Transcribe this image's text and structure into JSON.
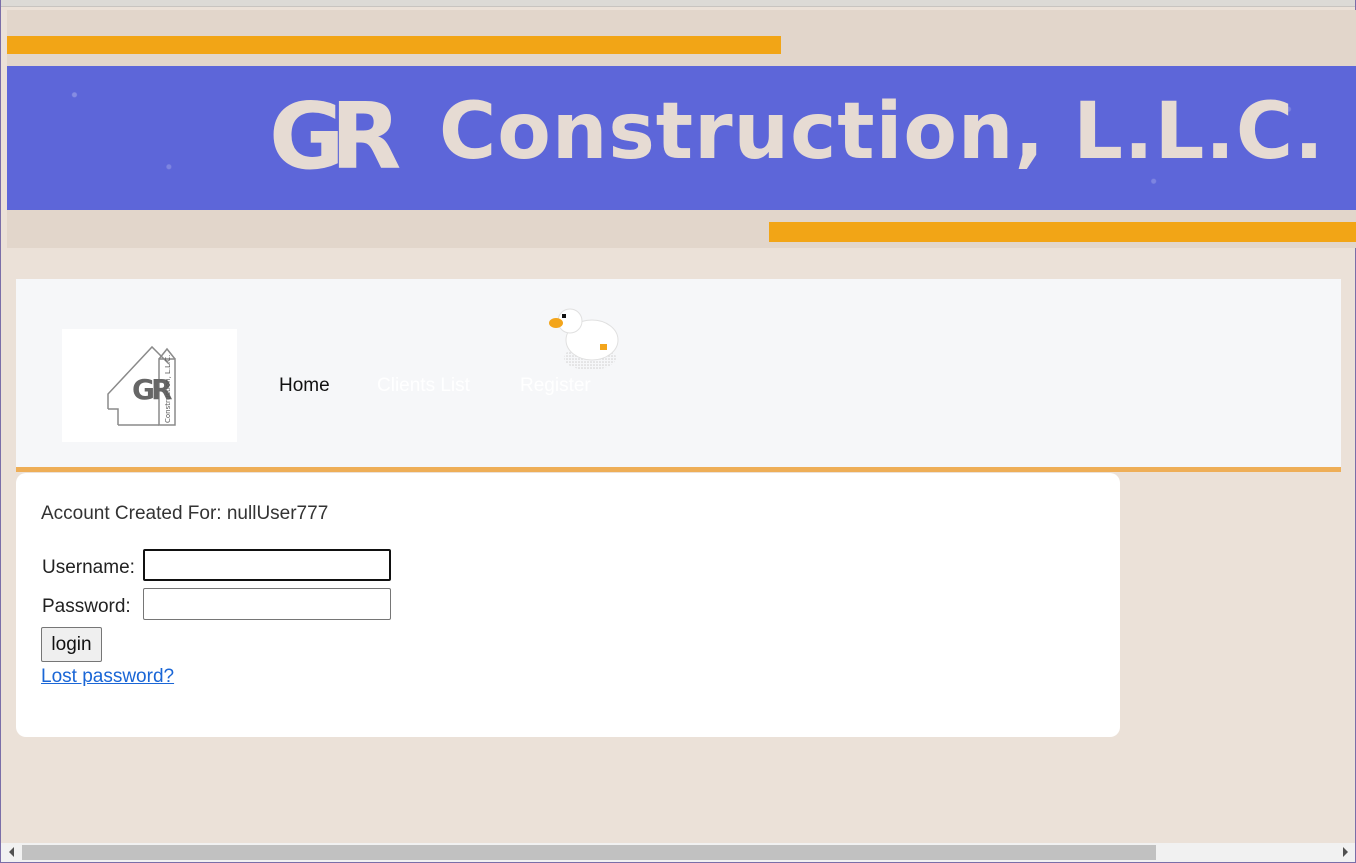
{
  "banner": {
    "logo_letters": "GR",
    "title": "Construction, L.L.C.",
    "colors": {
      "blue": "#5d66d9",
      "orange": "#f2a516",
      "cream": "#e6dbd3"
    }
  },
  "nav": {
    "logo_text": "Construction, L.L.C.",
    "links": [
      {
        "label": "Home"
      },
      {
        "label": "Clients List"
      },
      {
        "label": "Register"
      }
    ],
    "accent_color": "#eeae57"
  },
  "card": {
    "created_message": "Account Created For: nullUser777",
    "username_label": "Username:",
    "username_value": "",
    "password_label": "Password:",
    "password_value": "",
    "login_label": "login",
    "lost_password_label": "Lost password?"
  },
  "icons": {
    "duck": "duck-icon",
    "scroll_left": "chevron-left-icon",
    "scroll_right": "chevron-right-icon"
  }
}
